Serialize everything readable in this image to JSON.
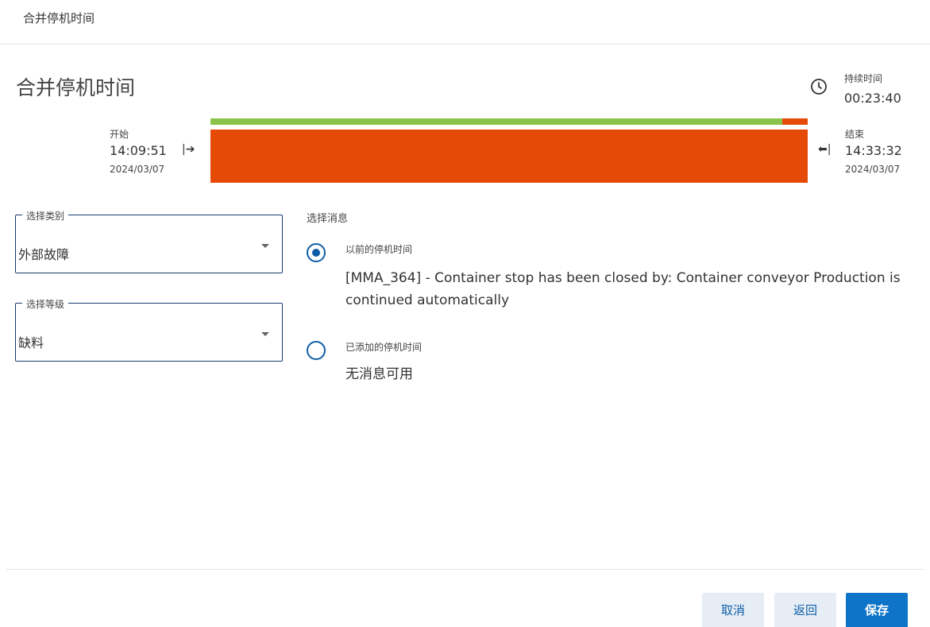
{
  "window": {
    "title": "合并停机时间"
  },
  "main": {
    "title": "合并停机时间"
  },
  "duration": {
    "label": "持续时间",
    "value": "00:23:40",
    "icon": "clock-icon"
  },
  "start": {
    "label": "开始",
    "time": "14:09:51",
    "date": "2024/03/07",
    "arrow": "|➔"
  },
  "end": {
    "label": "结束",
    "time": "14:33:32",
    "date": "2024/03/07",
    "arrow": "⬅|"
  },
  "timeline": {
    "green_fraction": 0.958,
    "colors": {
      "green": "#8bc34a",
      "red": "#e64a07"
    }
  },
  "category": {
    "legend": "选择类别",
    "value": "外部故障"
  },
  "level": {
    "legend": "选择等级",
    "value": "缺料"
  },
  "messages": {
    "heading": "选择消息",
    "options": [
      {
        "label": "以前的停机时间",
        "text": "[MMA_364] - Container stop has been closed by: Container conveyor Production is continued automatically",
        "selected": true
      },
      {
        "label": "已添加的停机时间",
        "text": "无消息可用",
        "selected": false
      }
    ]
  },
  "footer": {
    "cancel": "取消",
    "back": "返回",
    "save": "保存"
  },
  "colors": {
    "accent": "#0e74c8",
    "border": "#1a3a6e"
  }
}
